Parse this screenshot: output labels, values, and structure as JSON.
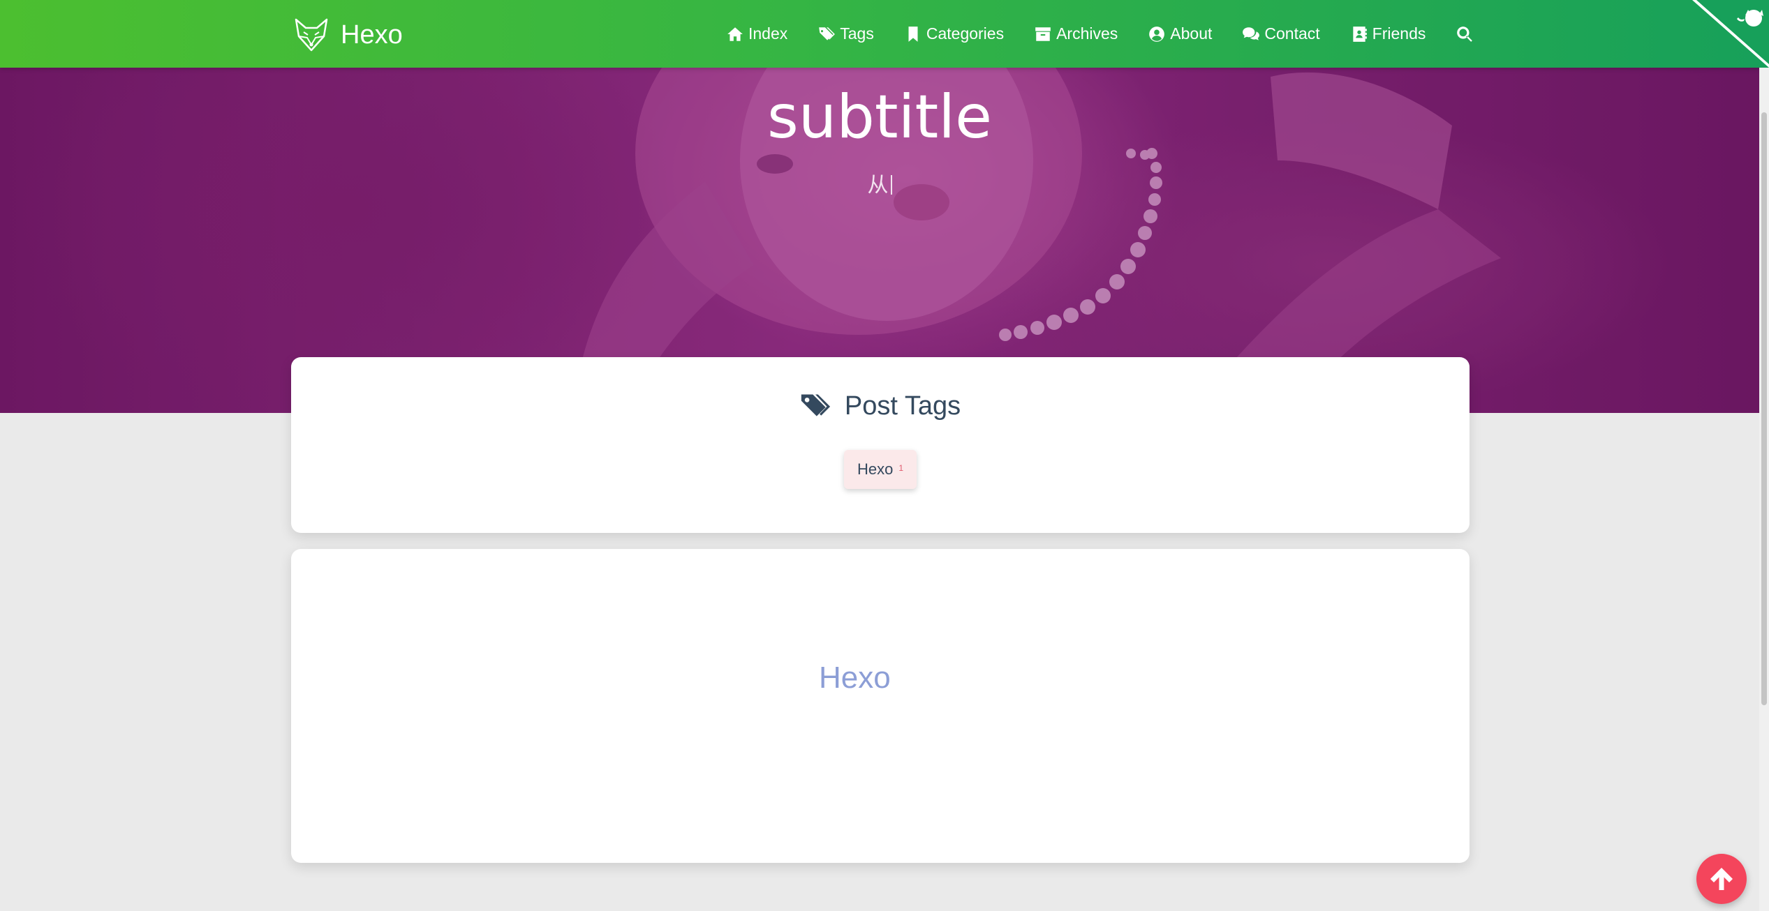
{
  "brand": {
    "name": "Hexo",
    "logo_icon": "fox-logo-icon"
  },
  "nav": {
    "items": [
      {
        "label": "Index",
        "icon": "home-icon"
      },
      {
        "label": "Tags",
        "icon": "tags-icon"
      },
      {
        "label": "Categories",
        "icon": "bookmark-icon"
      },
      {
        "label": "Archives",
        "icon": "archive-icon"
      },
      {
        "label": "About",
        "icon": "user-circle-icon"
      },
      {
        "label": "Contact",
        "icon": "comments-icon"
      },
      {
        "label": "Friends",
        "icon": "address-book-icon"
      }
    ],
    "search_icon": "search-icon"
  },
  "hero": {
    "title": "subtitle",
    "typed_text": "从"
  },
  "tags_card": {
    "title": "Post Tags",
    "tags": [
      {
        "label": "Hexo",
        "count": "1"
      }
    ]
  },
  "tag_cloud": {
    "words": [
      {
        "label": "Hexo"
      }
    ]
  },
  "colors": {
    "navbar_start": "#4cbf30",
    "navbar_end": "#17a05a",
    "hero_overlay": "#8f2d80",
    "back_to_top": "#f4455c",
    "cloud_word": "#8c9ed6",
    "tag_chip_bg": "#fbe9ea"
  }
}
